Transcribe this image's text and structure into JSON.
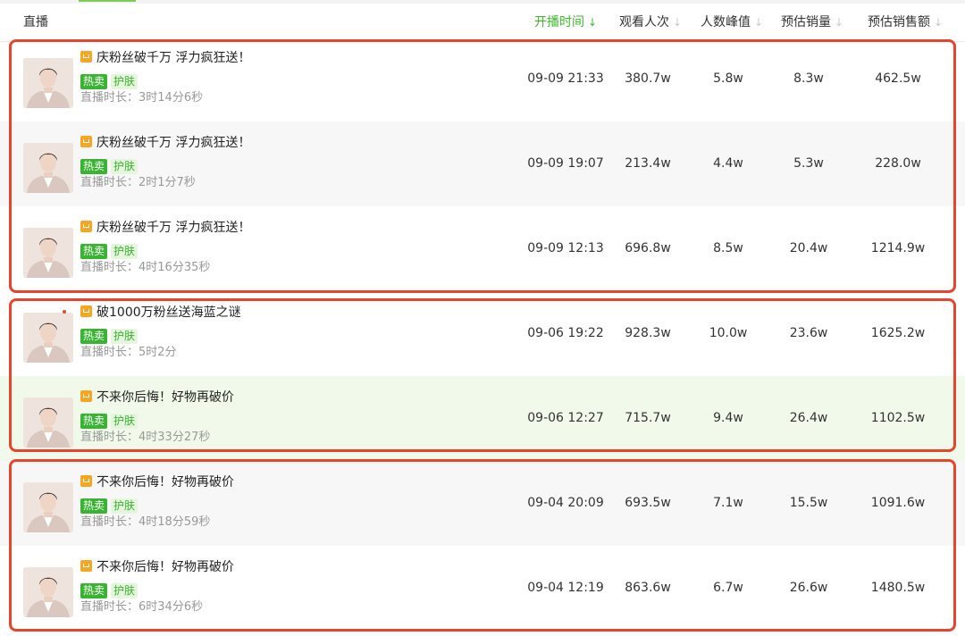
{
  "header": {
    "live_label": "直播",
    "columns": [
      {
        "label": "开播时间",
        "active": true
      },
      {
        "label": "观看人次",
        "active": false
      },
      {
        "label": "人数峰值",
        "active": false
      },
      {
        "label": "预估销量",
        "active": false
      },
      {
        "label": "预估销售额",
        "active": false
      }
    ]
  },
  "icons": {
    "sort": "sort-arrow-icon",
    "cart": "shopping-cart-icon"
  },
  "colors": {
    "accent": "#3db829",
    "highlight_border": "#e8442d",
    "cart": "#f5a623"
  },
  "rows": [
    {
      "title": "庆粉丝破千万 浮力疯狂送！",
      "tag_hot": "热卖",
      "tag_cat": "护肤",
      "duration": "直播时长：3时14分6秒",
      "start_time": "09-09 21:33",
      "views": "380.7w",
      "peak": "5.8w",
      "sales": "8.3w",
      "amount": "462.5w"
    },
    {
      "title": "庆粉丝破千万 浮力疯狂送！",
      "tag_hot": "热卖",
      "tag_cat": "护肤",
      "duration": "直播时长：2时1分7秒",
      "start_time": "09-09 19:07",
      "views": "213.4w",
      "peak": "4.4w",
      "sales": "5.3w",
      "amount": "228.0w"
    },
    {
      "title": "庆粉丝破千万 浮力疯狂送！",
      "tag_hot": "热卖",
      "tag_cat": "护肤",
      "duration": "直播时长：4时16分35秒",
      "start_time": "09-09 12:13",
      "views": "696.8w",
      "peak": "8.5w",
      "sales": "20.4w",
      "amount": "1214.9w"
    },
    {
      "title": "破1000万粉丝送海蓝之谜",
      "tag_hot": "热卖",
      "tag_cat": "护肤",
      "duration": "直播时长：5时2分",
      "start_time": "09-06 19:22",
      "views": "928.3w",
      "peak": "10.0w",
      "sales": "23.6w",
      "amount": "1625.2w"
    },
    {
      "title": "不来你后悔！好物再破价",
      "tag_hot": "热卖",
      "tag_cat": "护肤",
      "duration": "直播时长：4时33分27秒",
      "start_time": "09-06 12:27",
      "views": "715.7w",
      "peak": "9.4w",
      "sales": "26.4w",
      "amount": "1102.5w"
    },
    {
      "title": "不来你后悔！好物再破价",
      "tag_hot": "热卖",
      "tag_cat": "护肤",
      "duration": "直播时长：4时18分59秒",
      "start_time": "09-04 20:09",
      "views": "693.5w",
      "peak": "7.1w",
      "sales": "15.5w",
      "amount": "1091.6w"
    },
    {
      "title": "不来你后悔！好物再破价",
      "tag_hot": "热卖",
      "tag_cat": "护肤",
      "duration": "直播时长：6时34分6秒",
      "start_time": "09-04 12:19",
      "views": "863.6w",
      "peak": "6.7w",
      "sales": "26.6w",
      "amount": "1480.5w"
    }
  ]
}
